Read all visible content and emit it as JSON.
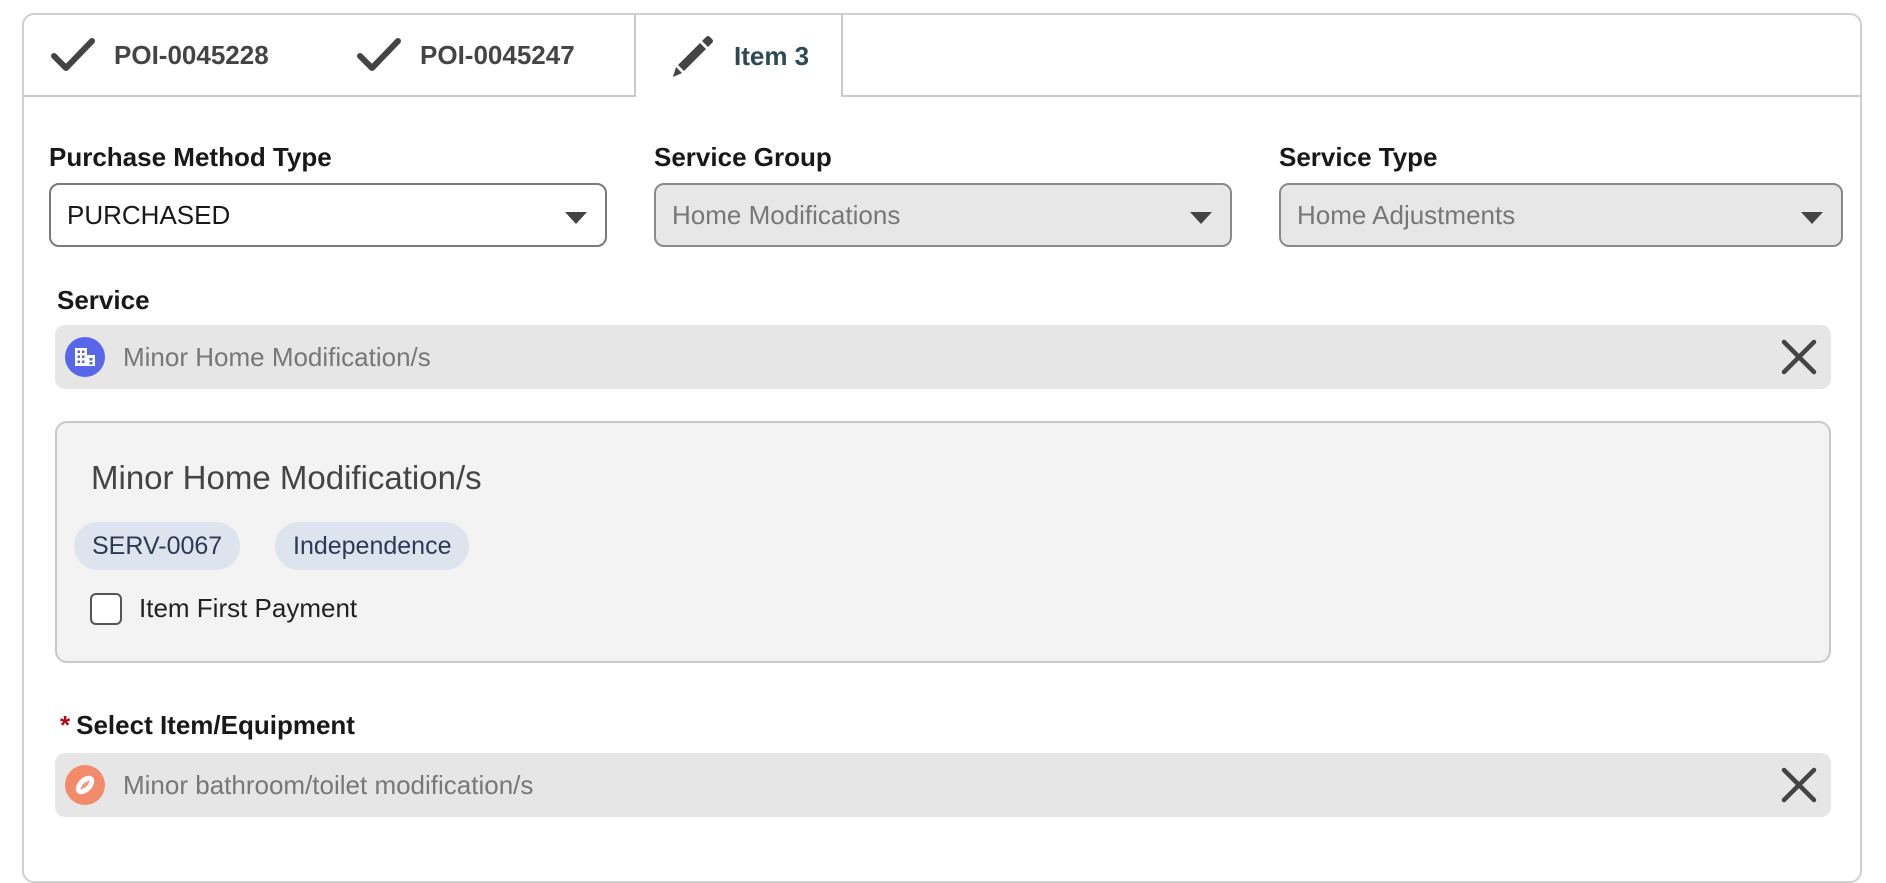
{
  "tabs": [
    {
      "label": "POI-0045228",
      "icon": "checkmark-icon",
      "state": "complete"
    },
    {
      "label": "POI-0045247",
      "icon": "checkmark-icon",
      "state": "complete"
    },
    {
      "label": "Item 3",
      "icon": "pencil-icon",
      "state": "active"
    }
  ],
  "fields": {
    "purchase_method_type": {
      "label": "Purchase Method Type",
      "value": "PURCHASED"
    },
    "service_group": {
      "label": "Service Group",
      "value": "Home Modifications"
    },
    "service_type": {
      "label": "Service Type",
      "value": "Home Adjustments"
    },
    "service": {
      "label": "Service",
      "value": "Minor Home Modification/s",
      "icon": "building-icon"
    },
    "select_item": {
      "required_mark": "*",
      "label": "Select Item/Equipment",
      "value": "Minor bathroom/toilet modification/s",
      "icon": "football-icon"
    }
  },
  "service_detail": {
    "title": "Minor Home Modification/s",
    "badges": [
      "SERV-0067",
      "Independence"
    ],
    "checkbox_label": "Item First Payment",
    "checkbox_checked": false
  },
  "colors": {
    "service_icon_bg": "#5867e8",
    "item_icon_bg": "#f38b6b",
    "required": "#ba0517"
  }
}
